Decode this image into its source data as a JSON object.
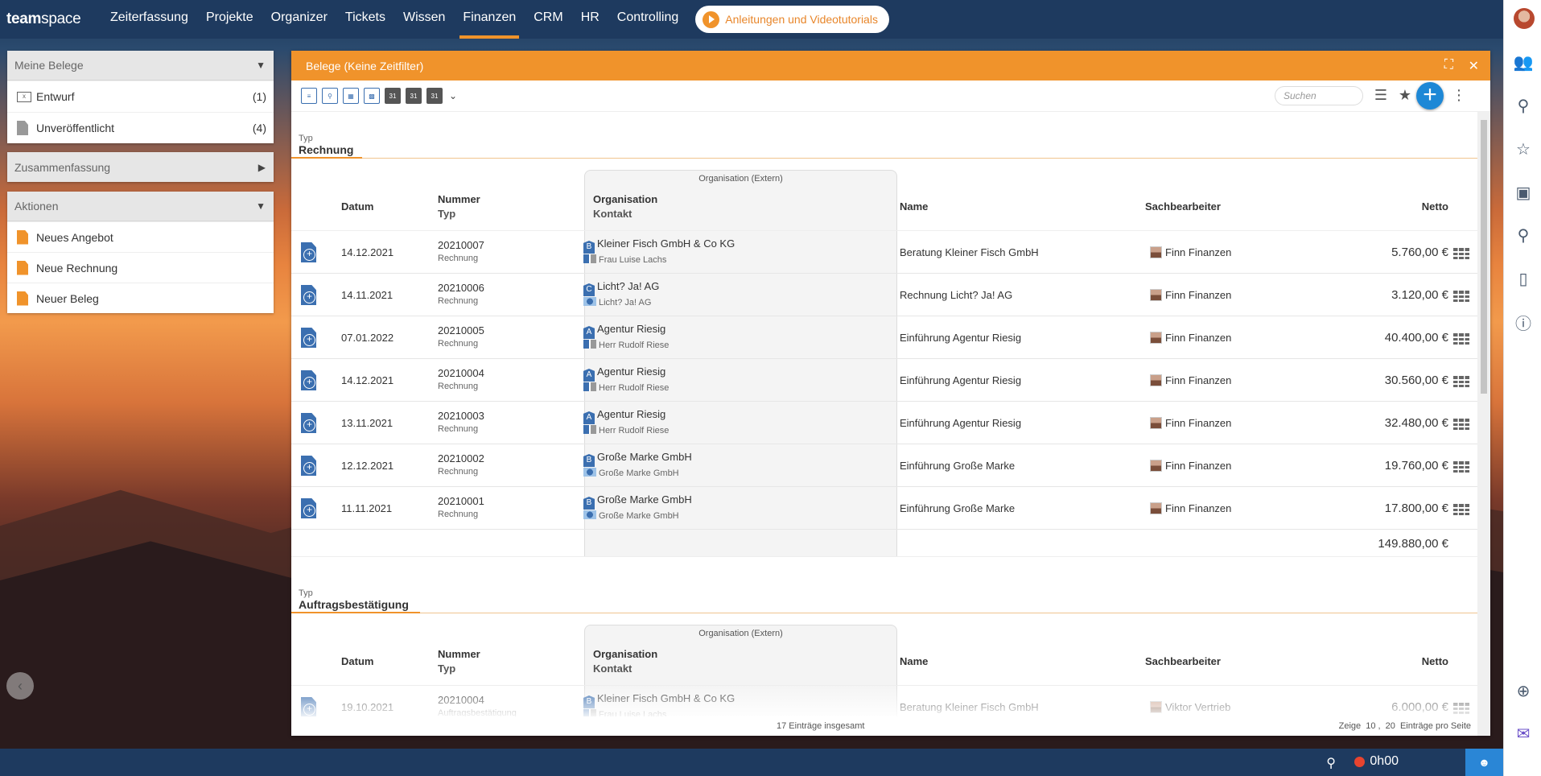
{
  "app": {
    "logo_bold": "team",
    "logo_light": "space"
  },
  "nav": {
    "items": [
      "Zeiterfassung",
      "Projekte",
      "Organizer",
      "Tickets",
      "Wissen",
      "Finanzen",
      "CRM",
      "HR",
      "Controlling"
    ],
    "active": "Finanzen",
    "tutorial_label": "Anleitungen und Videotutorials"
  },
  "left": {
    "meine_belege": {
      "title": "Meine Belege",
      "items": [
        {
          "label": "Entwurf",
          "count": "(1)"
        },
        {
          "label": "Unveröffentlicht",
          "count": "(4)"
        }
      ]
    },
    "zusammenfassung": {
      "title": "Zusammenfassung"
    },
    "aktionen": {
      "title": "Aktionen",
      "items": [
        "Neues Angebot",
        "Neue Rechnung",
        "Neuer Beleg"
      ]
    }
  },
  "window": {
    "title": "Belege (Keine Zeitfilter)",
    "search_placeholder": "Suchen"
  },
  "columns": {
    "datum": "Datum",
    "nummer": "Nummer",
    "typ": "Typ",
    "org_caption": "Organisation (Extern)",
    "organisation": "Organisation",
    "kontakt": "Kontakt",
    "name": "Name",
    "sachbearbeiter": "Sachbearbeiter",
    "netto": "Netto"
  },
  "groups": [
    {
      "type_label": "Typ",
      "type_value": "Rechnung",
      "rows": [
        {
          "datum": "14.12.2021",
          "nummer": "20210007",
          "typ": "Rechnung",
          "org_badge": "B",
          "organisation": "Kleiner Fisch GmbH & Co KG",
          "kontakt": "Frau Luise Lachs",
          "name": "Beratung Kleiner Fisch GmbH",
          "sachbearbeiter": "Finn Finanzen",
          "netto": "5.760,00 €"
        },
        {
          "datum": "14.11.2021",
          "nummer": "20210006",
          "typ": "Rechnung",
          "org_badge": "C",
          "organisation": "Licht? Ja! AG",
          "kontakt": "Licht? Ja! AG",
          "name": "Rechnung Licht? Ja! AG",
          "sachbearbeiter": "Finn Finanzen",
          "netto": "3.120,00 €"
        },
        {
          "datum": "07.01.2022",
          "nummer": "20210005",
          "typ": "Rechnung",
          "org_badge": "A",
          "organisation": "Agentur Riesig",
          "kontakt": "Herr Rudolf Riese",
          "name": "Einführung Agentur Riesig",
          "sachbearbeiter": "Finn Finanzen",
          "netto": "40.400,00 €"
        },
        {
          "datum": "14.12.2021",
          "nummer": "20210004",
          "typ": "Rechnung",
          "org_badge": "A",
          "organisation": "Agentur Riesig",
          "kontakt": "Herr Rudolf Riese",
          "name": "Einführung Agentur Riesig",
          "sachbearbeiter": "Finn Finanzen",
          "netto": "30.560,00 €"
        },
        {
          "datum": "13.11.2021",
          "nummer": "20210003",
          "typ": "Rechnung",
          "org_badge": "A",
          "organisation": "Agentur Riesig",
          "kontakt": "Herr Rudolf Riese",
          "name": "Einführung Agentur Riesig",
          "sachbearbeiter": "Finn Finanzen",
          "netto": "32.480,00 €"
        },
        {
          "datum": "12.12.2021",
          "nummer": "20210002",
          "typ": "Rechnung",
          "org_badge": "B",
          "organisation": "Große Marke GmbH",
          "kontakt": "Große Marke GmbH",
          "name": "Einführung Große Marke",
          "sachbearbeiter": "Finn Finanzen",
          "netto": "19.760,00 €"
        },
        {
          "datum": "11.11.2021",
          "nummer": "20210001",
          "typ": "Rechnung",
          "org_badge": "B",
          "organisation": "Große Marke GmbH",
          "kontakt": "Große Marke GmbH",
          "name": "Einführung Große Marke",
          "sachbearbeiter": "Finn Finanzen",
          "netto": "17.800,00 €"
        }
      ],
      "sum": "149.880,00 €"
    },
    {
      "type_label": "Typ",
      "type_value": "Auftragsbestätigung",
      "rows": [
        {
          "datum": "19.10.2021",
          "nummer": "20210004",
          "typ": "Auftragsbestätigung",
          "org_badge": "B",
          "organisation": "Kleiner Fisch GmbH & Co KG",
          "kontakt": "Frau Luise Lachs",
          "name": "Beratung Kleiner Fisch GmbH",
          "sachbearbeiter": "Viktor Vertrieb",
          "netto": "6.000,00 €"
        }
      ]
    }
  ],
  "footer": {
    "total": "17 Einträge insgesamt",
    "pager_prefix": "Zeige",
    "pager_10": "10",
    "pager_sep": ",",
    "pager_20": "20",
    "pager_suffix": "Einträge pro Seite"
  },
  "bottombar": {
    "timer": "0h00"
  }
}
